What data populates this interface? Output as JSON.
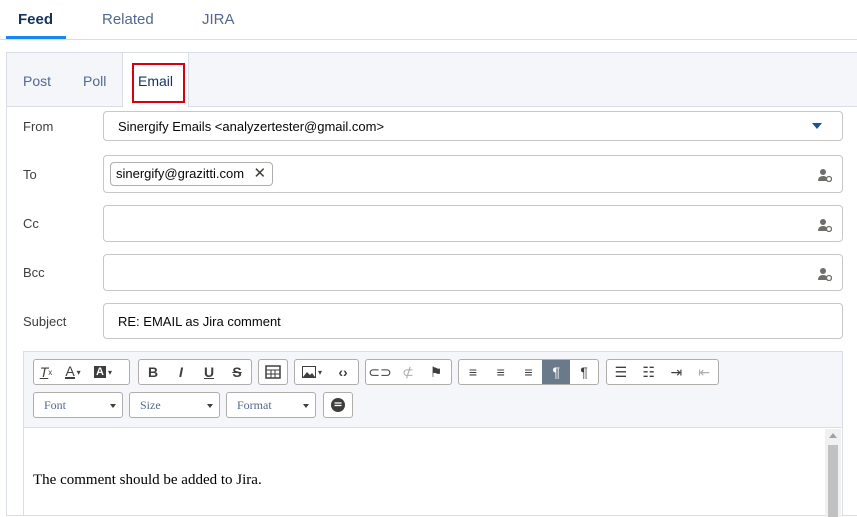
{
  "top_tabs": [
    {
      "label": "Feed",
      "active": true
    },
    {
      "label": "Related",
      "active": false
    },
    {
      "label": "JIRA",
      "active": false
    }
  ],
  "sub_tabs": [
    {
      "label": "Post"
    },
    {
      "label": "Poll"
    },
    {
      "label": "Email",
      "active": true
    }
  ],
  "form": {
    "from_label": "From",
    "from_value": "Sinergify Emails <analyzertester@gmail.com>",
    "to_label": "To",
    "to_pill": "sinergify@grazitti.com",
    "cc_label": "Cc",
    "bcc_label": "Bcc",
    "subject_label": "Subject",
    "subject_value": "RE: EMAIL as Jira comment"
  },
  "editor": {
    "font_select": "Font",
    "size_select": "Size",
    "format_select": "Format",
    "body": "The comment should be added to Jira."
  },
  "colors": {
    "accent": "#1589ee",
    "highlight": "#d9000d",
    "dropdown_caret": "#1b5297"
  }
}
